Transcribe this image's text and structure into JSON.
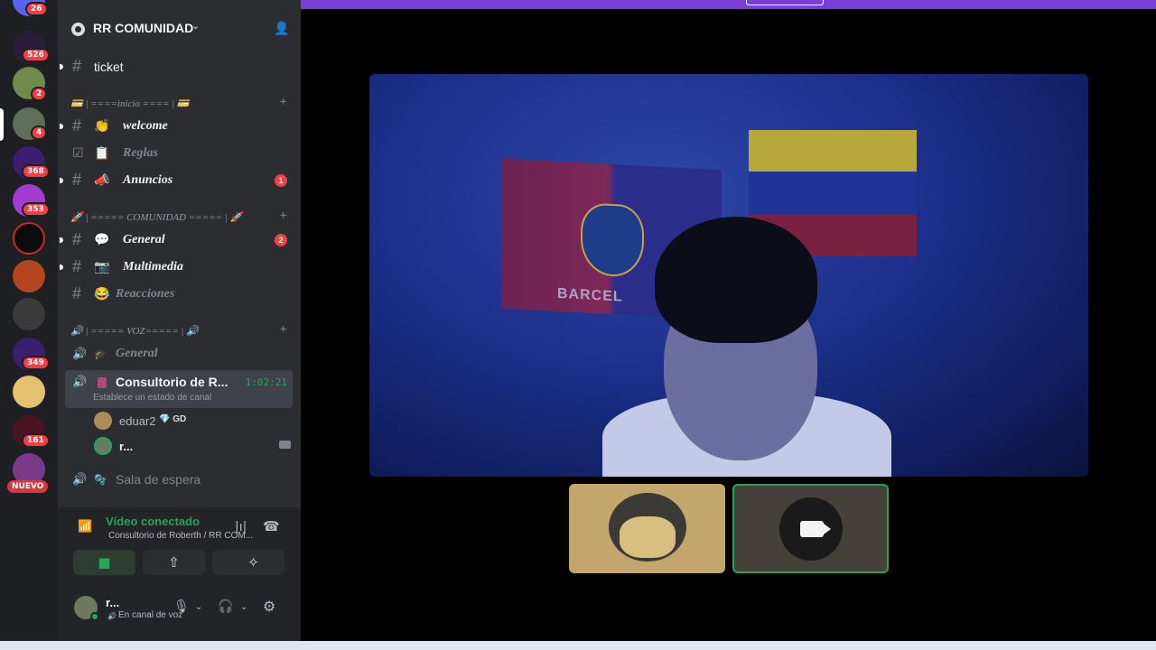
{
  "rail": {
    "badges": [
      "26",
      "526",
      "2",
      "4",
      "368",
      "353",
      "349",
      "161"
    ],
    "nuevo_label": "NUEVO"
  },
  "server": {
    "name": "RR COMUNIDAD"
  },
  "channels": [
    {
      "name": "ticket",
      "emoji": ""
    },
    {
      "name": "welcome",
      "emoji": "👏"
    },
    {
      "name": "Reglas",
      "emoji": "📋"
    },
    {
      "name": "Anuncios",
      "emoji": "📣",
      "unread": "1"
    },
    {
      "name": "General",
      "emoji": "💬",
      "unread": "2"
    },
    {
      "name": "Multimedia",
      "emoji": "📷"
    },
    {
      "name": "Reacciones",
      "emoji": "😂"
    }
  ],
  "categories": {
    "inicio": "💳 | ====inicio ==== | 💳",
    "comunidad": "🚀 | ===== COMUNIDAD ===== | 🚀",
    "voz": "🔊 | ===== VOZ===== | 🔊"
  },
  "voice_channels": {
    "general": "General",
    "consultorio": "Consultorio de R...",
    "timer": "1:02:21",
    "status_placeholder": "Establece un estado de canal",
    "sala": "Sala de espera"
  },
  "members": [
    {
      "name": "eduar2",
      "tag": "💎 GD"
    },
    {
      "name": "r..."
    }
  ],
  "voice_panel": {
    "title": "Vídeo conectado",
    "subtitle": "Consultorio de Roberth / RR COM..."
  },
  "user": {
    "name": "r...",
    "status": "En canal de voz"
  },
  "video": {
    "wall_text": "BARCEL"
  }
}
